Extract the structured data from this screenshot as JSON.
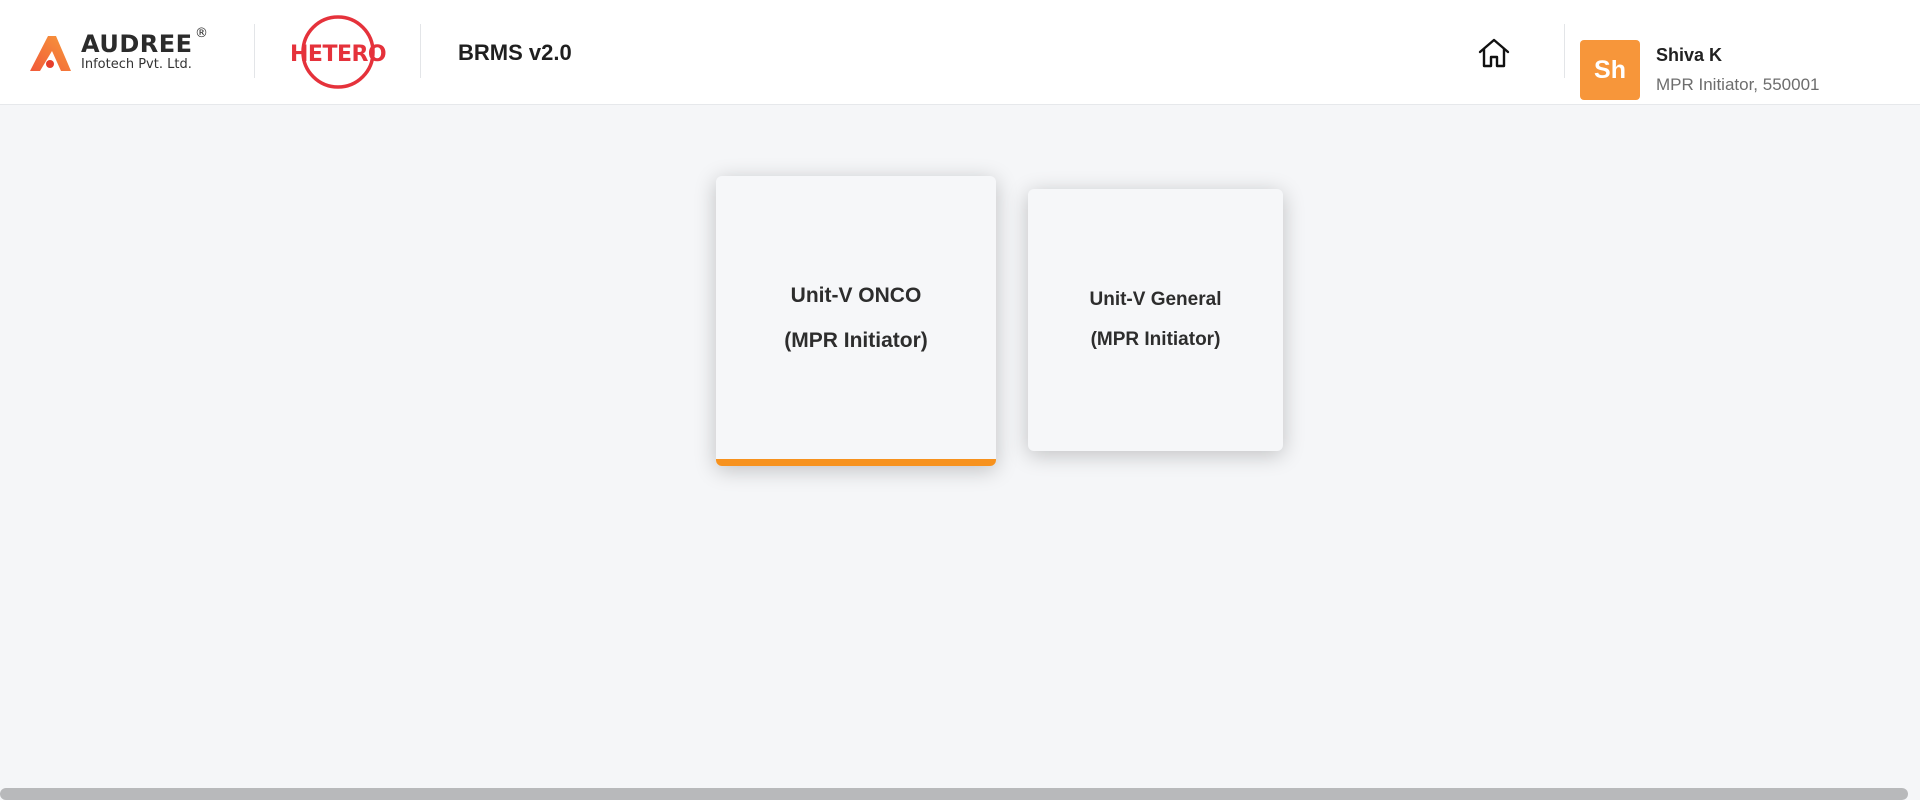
{
  "header": {
    "audree_logo": {
      "name": "AUDREE",
      "registered": "®",
      "subtitle": "Infotech Pvt. Ltd."
    },
    "hetero_logo": {
      "name": "HETERO"
    },
    "app_title": "BRMS v2.0",
    "home_icon": "home-icon",
    "user": {
      "initials": "Sh",
      "name": "Shiva K",
      "role": "MPR Initiator, 550001"
    }
  },
  "cards": [
    {
      "line1": "Unit-V ONCO",
      "line2": "(MPR Initiator)",
      "selected": true
    },
    {
      "line1": "Unit-V General",
      "line2": "(MPR Initiator)",
      "selected": false
    }
  ],
  "colors": {
    "accent": "#f7921e",
    "avatar": "#f7963a",
    "hetero_red": "#e5323b",
    "background": "#f5f6f8"
  }
}
